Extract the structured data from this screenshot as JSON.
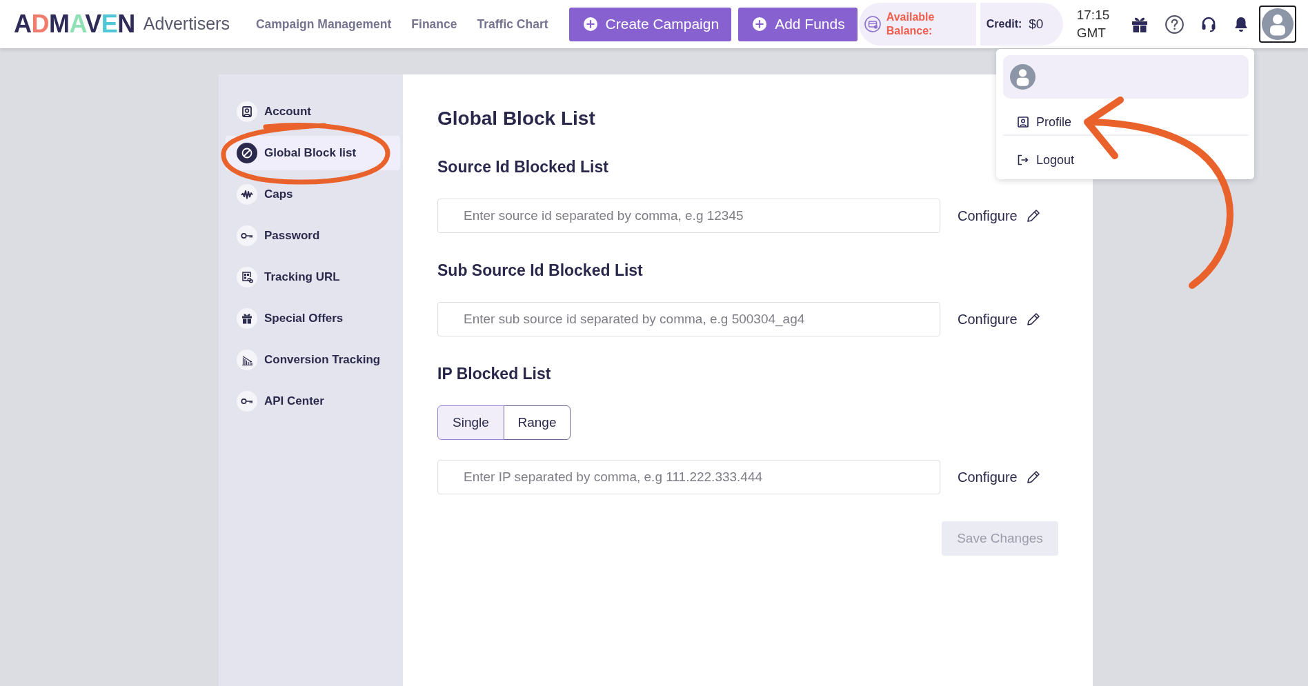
{
  "header": {
    "logo": "ADMAVEN",
    "app_name": "Advertisers",
    "nav": [
      {
        "label": "Campaign Management"
      },
      {
        "label": "Finance"
      },
      {
        "label": "Traffic Chart"
      }
    ],
    "actions": [
      {
        "label": "Create Campaign"
      },
      {
        "label": "Add Funds"
      }
    ],
    "balance": {
      "label": "Available Balance:"
    },
    "credit": {
      "label": "Credit:",
      "value": "$0"
    },
    "clock": {
      "time": "17:15",
      "zone": "GMT"
    }
  },
  "user_menu": {
    "expanded": true,
    "items": [
      {
        "kind": "profile",
        "label": "Profile"
      },
      {
        "kind": "logout",
        "label": "Logout"
      }
    ]
  },
  "sidebar": {
    "items": [
      {
        "kind": "account",
        "label": "Account",
        "selected": false
      },
      {
        "kind": "block",
        "label": "Global Block list",
        "selected": true
      },
      {
        "kind": "caps",
        "label": "Caps",
        "selected": false
      },
      {
        "kind": "password",
        "label": "Password",
        "selected": false
      },
      {
        "kind": "tracking",
        "label": "Tracking URL",
        "selected": false
      },
      {
        "kind": "offers",
        "label": "Special Offers",
        "selected": false
      },
      {
        "kind": "conversion",
        "label": "Conversion Tracking",
        "selected": false
      },
      {
        "kind": "api",
        "label": "API Center",
        "selected": false
      }
    ]
  },
  "content": {
    "title": "Global Block List",
    "sections": [
      {
        "heading": "Source Id Blocked List",
        "placeholder": "Enter source id separated by comma, e.g 12345",
        "action": "Configure"
      },
      {
        "heading": "Sub Source Id Blocked List",
        "placeholder": "Enter sub source id separated by comma, e.g 500304_ag4",
        "action": "Configure"
      },
      {
        "heading": "IP Blocked List",
        "modes": [
          {
            "label": "Single",
            "selected": true
          },
          {
            "label": "Range",
            "selected": false
          }
        ],
        "placeholder": "Enter IP separated by comma, e.g 111.222.333.444",
        "action": "Configure"
      }
    ],
    "save_button": {
      "label": "Save Changes",
      "disabled": true
    }
  }
}
